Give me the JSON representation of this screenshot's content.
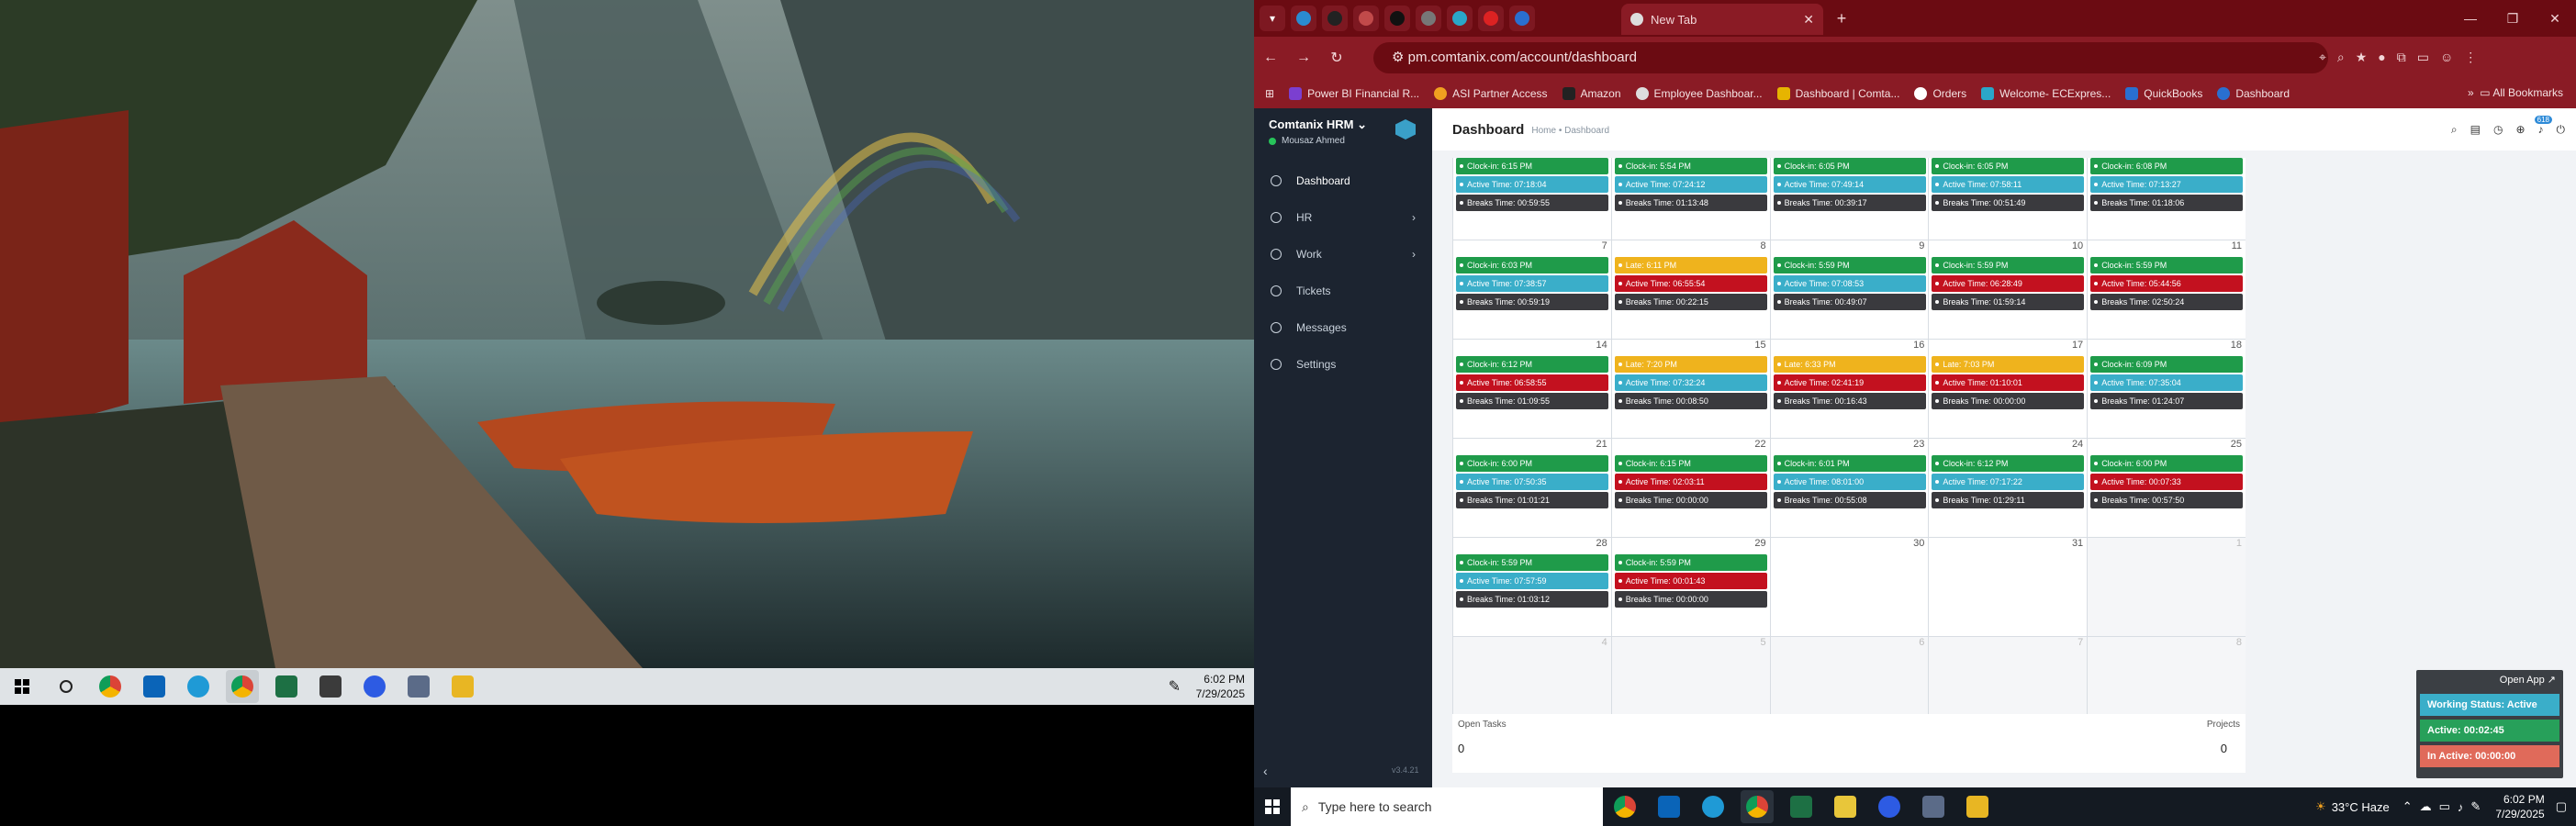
{
  "left_screen": {
    "taskbar": {
      "icons": [
        "windows-icon",
        "search-icon",
        "chrome-icon",
        "outlook-icon",
        "edge-icon",
        "chrome-profile-icon",
        "excel-icon",
        "sticky-notes-icon",
        "zoom-icon",
        "calculator-icon",
        "file-explorer-icon"
      ],
      "time": "6:02 PM",
      "date": "7/29/2025"
    }
  },
  "browser": {
    "tabs": {
      "active_title": "New Tab"
    },
    "address": "pm.comtanix.com/account/dashboard",
    "bookmarks": [
      "Power BI Financial R...",
      "ASI Partner Access",
      "Amazon",
      "Employee Dashboar...",
      "Dashboard | Comta...",
      "Orders",
      "Welcome- ECExpres...",
      "QuickBooks",
      "Dashboard"
    ],
    "all_bookmarks": "All Bookmarks"
  },
  "app": {
    "brand": "Comtanix HRM",
    "user": "Mousaz Ahmed",
    "menu": [
      "Dashboard",
      "HR",
      "Work",
      "Tickets",
      "Messages",
      "Settings"
    ],
    "version": "v3.4.21",
    "page_title": "Dashboard",
    "breadcrumb": "Home • Dashboard",
    "notif_count": "618",
    "calendar": {
      "weeks": [
        {
          "days": [
            {
              "num": "",
              "pills": [
                [
                  "g",
                  "Clock-in: 6:15 PM"
                ],
                [
                  "b",
                  "Active Time: 07:18:04"
                ],
                [
                  "d",
                  "Breaks Time: 00:59:55"
                ]
              ]
            },
            {
              "num": "",
              "pills": [
                [
                  "g",
                  "Clock-in: 5:54 PM"
                ],
                [
                  "b",
                  "Active Time: 07:24:12"
                ],
                [
                  "d",
                  "Breaks Time: 01:13:48"
                ]
              ]
            },
            {
              "num": "",
              "pills": [
                [
                  "g",
                  "Clock-in: 6:05 PM"
                ],
                [
                  "b",
                  "Active Time: 07:49:14"
                ],
                [
                  "d",
                  "Breaks Time: 00:39:17"
                ]
              ]
            },
            {
              "num": "",
              "pills": [
                [
                  "g",
                  "Clock-in: 6:05 PM"
                ],
                [
                  "b",
                  "Active Time: 07:58:11"
                ],
                [
                  "d",
                  "Breaks Time: 00:51:49"
                ]
              ]
            },
            {
              "num": "",
              "pills": [
                [
                  "g",
                  "Clock-in: 6:08 PM"
                ],
                [
                  "b",
                  "Active Time: 07:13:27"
                ],
                [
                  "d",
                  "Breaks Time: 01:18:06"
                ]
              ]
            }
          ]
        },
        {
          "days": [
            {
              "num": "7",
              "pills": [
                [
                  "g",
                  "Clock-in: 6:03 PM"
                ],
                [
                  "b",
                  "Active Time: 07:38:57"
                ],
                [
                  "d",
                  "Breaks Time: 00:59:19"
                ]
              ]
            },
            {
              "num": "8",
              "pills": [
                [
                  "y",
                  "Late: 6:11 PM"
                ],
                [
                  "r",
                  "Active Time: 06:55:54"
                ],
                [
                  "d",
                  "Breaks Time: 00:22:15"
                ]
              ]
            },
            {
              "num": "9",
              "pills": [
                [
                  "g",
                  "Clock-in: 5:59 PM"
                ],
                [
                  "b",
                  "Active Time: 07:08:53"
                ],
                [
                  "d",
                  "Breaks Time: 00:49:07"
                ]
              ]
            },
            {
              "num": "10",
              "pills": [
                [
                  "g",
                  "Clock-in: 5:59 PM"
                ],
                [
                  "r",
                  "Active Time: 06:28:49"
                ],
                [
                  "d",
                  "Breaks Time: 01:59:14"
                ]
              ]
            },
            {
              "num": "11",
              "pills": [
                [
                  "g",
                  "Clock-in: 5:59 PM"
                ],
                [
                  "r",
                  "Active Time: 05:44:56"
                ],
                [
                  "d",
                  "Breaks Time: 02:50:24"
                ]
              ]
            }
          ]
        },
        {
          "days": [
            {
              "num": "14",
              "pills": [
                [
                  "g",
                  "Clock-in: 6:12 PM"
                ],
                [
                  "r",
                  "Active Time: 06:58:55"
                ],
                [
                  "d",
                  "Breaks Time: 01:09:55"
                ]
              ]
            },
            {
              "num": "15",
              "pills": [
                [
                  "y",
                  "Late: 7:20 PM"
                ],
                [
                  "b",
                  "Active Time: 07:32:24"
                ],
                [
                  "d",
                  "Breaks Time: 00:08:50"
                ]
              ]
            },
            {
              "num": "16",
              "pills": [
                [
                  "y",
                  "Late: 6:33 PM"
                ],
                [
                  "r",
                  "Active Time: 02:41:19"
                ],
                [
                  "d",
                  "Breaks Time: 00:16:43"
                ]
              ]
            },
            {
              "num": "17",
              "pills": [
                [
                  "y",
                  "Late: 7:03 PM"
                ],
                [
                  "r",
                  "Active Time: 01:10:01"
                ],
                [
                  "d",
                  "Breaks Time: 00:00:00"
                ]
              ]
            },
            {
              "num": "18",
              "pills": [
                [
                  "g",
                  "Clock-in: 6:09 PM"
                ],
                [
                  "b",
                  "Active Time: 07:35:04"
                ],
                [
                  "d",
                  "Breaks Time: 01:24:07"
                ]
              ]
            }
          ]
        },
        {
          "days": [
            {
              "num": "21",
              "pills": [
                [
                  "g",
                  "Clock-in: 6:00 PM"
                ],
                [
                  "b",
                  "Active Time: 07:50:35"
                ],
                [
                  "d",
                  "Breaks Time: 01:01:21"
                ]
              ]
            },
            {
              "num": "22",
              "pills": [
                [
                  "g",
                  "Clock-in: 6:15 PM"
                ],
                [
                  "r",
                  "Active Time: 02:03:11"
                ],
                [
                  "d",
                  "Breaks Time: 00:00:00"
                ]
              ]
            },
            {
              "num": "23",
              "pills": [
                [
                  "g",
                  "Clock-in: 6:01 PM"
                ],
                [
                  "b",
                  "Active Time: 08:01:00"
                ],
                [
                  "d",
                  "Breaks Time: 00:55:08"
                ]
              ]
            },
            {
              "num": "24",
              "pills": [
                [
                  "g",
                  "Clock-in: 6:12 PM"
                ],
                [
                  "b",
                  "Active Time: 07:17:22"
                ],
                [
                  "d",
                  "Breaks Time: 01:29:11"
                ]
              ]
            },
            {
              "num": "25",
              "pills": [
                [
                  "g",
                  "Clock-in: 6:00 PM"
                ],
                [
                  "r",
                  "Active Time: 00:07:33"
                ],
                [
                  "d",
                  "Breaks Time: 00:57:50"
                ]
              ]
            }
          ]
        },
        {
          "days": [
            {
              "num": "28",
              "pills": [
                [
                  "g",
                  "Clock-in: 5:59 PM"
                ],
                [
                  "b",
                  "Active Time: 07:57:59"
                ],
                [
                  "d",
                  "Breaks Time: 01:03:12"
                ]
              ]
            },
            {
              "num": "29",
              "pills": [
                [
                  "g",
                  "Clock-in: 5:59 PM"
                ],
                [
                  "r",
                  "Active Time: 00:01:43"
                ],
                [
                  "d",
                  "Breaks Time: 00:00:00"
                ]
              ]
            },
            {
              "num": "30",
              "pills": []
            },
            {
              "num": "31",
              "pills": []
            },
            {
              "num": "1",
              "dim": true,
              "pills": []
            }
          ]
        },
        {
          "days": [
            {
              "num": "4",
              "dim": true,
              "pills": []
            },
            {
              "num": "5",
              "dim": true,
              "pills": []
            },
            {
              "num": "6",
              "dim": true,
              "pills": []
            },
            {
              "num": "7",
              "dim": true,
              "pills": []
            },
            {
              "num": "8",
              "dim": true,
              "pills": []
            }
          ]
        }
      ]
    },
    "open_tasks_label": "Open Tasks",
    "open_tasks_value": "0",
    "projects_label": "Projects",
    "projects_value": "0",
    "widget": {
      "open": "Open App ↗",
      "status": "Working Status: Active",
      "active": "Active: 00:02:45",
      "inactive": "In Active: 00:00:00"
    }
  },
  "right_taskbar": {
    "search_placeholder": "Type here to search",
    "weather": "33°C  Haze",
    "time": "6:02 PM",
    "date": "7/29/2025"
  }
}
